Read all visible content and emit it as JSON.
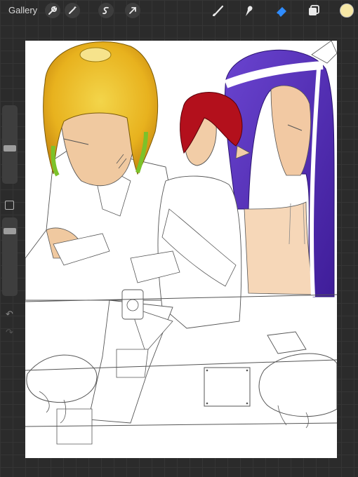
{
  "app": {
    "gallery_label": "Gallery"
  },
  "toolbar": {
    "left_icons": [
      "wrench-icon",
      "magic-wand-icon",
      "selection-icon",
      "transform-arrow-icon"
    ],
    "right_icons": [
      "brush-icon",
      "smudge-icon",
      "eraser-icon",
      "layers-icon"
    ],
    "active_tool": "eraser-icon",
    "active_tool_color": "#2f8cff",
    "current_color": "#f7e8a6"
  },
  "sidebar": {
    "brush_size_level": 0.45,
    "opacity_level": 0.15,
    "icons": [
      "modify-button-icon",
      "undo-icon",
      "redo-icon"
    ]
  },
  "canvas": {
    "background": "#ffffff",
    "palette": {
      "hair_yellow": "#e8b21e",
      "hair_green": "#7cc22a",
      "hair_red": "#b3101c",
      "hair_purple": "#5a2fb8",
      "skin": "#f0c9a0",
      "line": "#555555"
    }
  }
}
